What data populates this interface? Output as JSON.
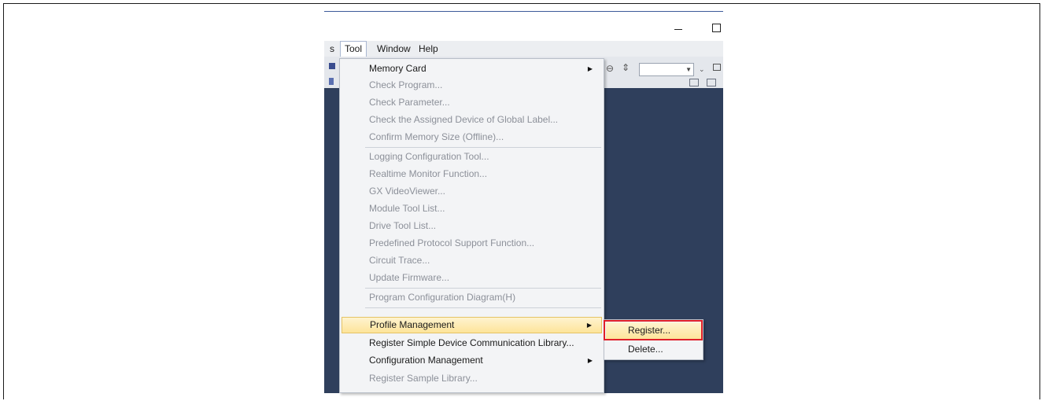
{
  "menubar": {
    "partial_item": "s",
    "items": [
      {
        "label": "Tool",
        "active": true
      },
      {
        "label": "Window",
        "active": false
      },
      {
        "label": "Help",
        "active": false
      }
    ]
  },
  "toolbar": {
    "zoom_out_icon": "zoom-out-icon",
    "combo_value": ""
  },
  "tool_menu": {
    "items": [
      {
        "label": "Memory Card",
        "enabled": true,
        "submenu": true
      },
      {
        "label": "Check Program...",
        "enabled": false
      },
      {
        "label": "Check Parameter...",
        "enabled": false
      },
      {
        "label": "Check the Assigned Device of Global Label...",
        "enabled": false
      },
      {
        "label": "Confirm Memory Size (Offline)...",
        "enabled": false
      },
      {
        "label": "Logging Configuration Tool...",
        "enabled": false
      },
      {
        "label": "Realtime Monitor Function...",
        "enabled": false
      },
      {
        "label": "GX VideoViewer...",
        "enabled": false
      },
      {
        "label": "Module Tool List...",
        "enabled": false
      },
      {
        "label": "Drive Tool List...",
        "enabled": false
      },
      {
        "label": "Predefined Protocol Support Function...",
        "enabled": false
      },
      {
        "label": "Circuit Trace...",
        "enabled": false
      },
      {
        "label": "Update Firmware...",
        "enabled": false
      },
      {
        "label": "Program Configuration Diagram(H)",
        "enabled": false
      },
      {
        "label": "Profile Management",
        "enabled": true,
        "submenu": true,
        "highlighted": true
      },
      {
        "label": "Register Simple Device Communication Library...",
        "enabled": true
      },
      {
        "label": "Configuration Management",
        "enabled": true,
        "submenu": true
      },
      {
        "label": "Register Sample Library...",
        "enabled": false
      }
    ]
  },
  "profile_submenu": {
    "items": [
      {
        "label": "Register...",
        "highlighted": true
      },
      {
        "label": "Delete...",
        "highlighted": false
      }
    ]
  },
  "colors": {
    "highlight_border": "#e0202a",
    "workspace_background": "#2f3f5c"
  }
}
